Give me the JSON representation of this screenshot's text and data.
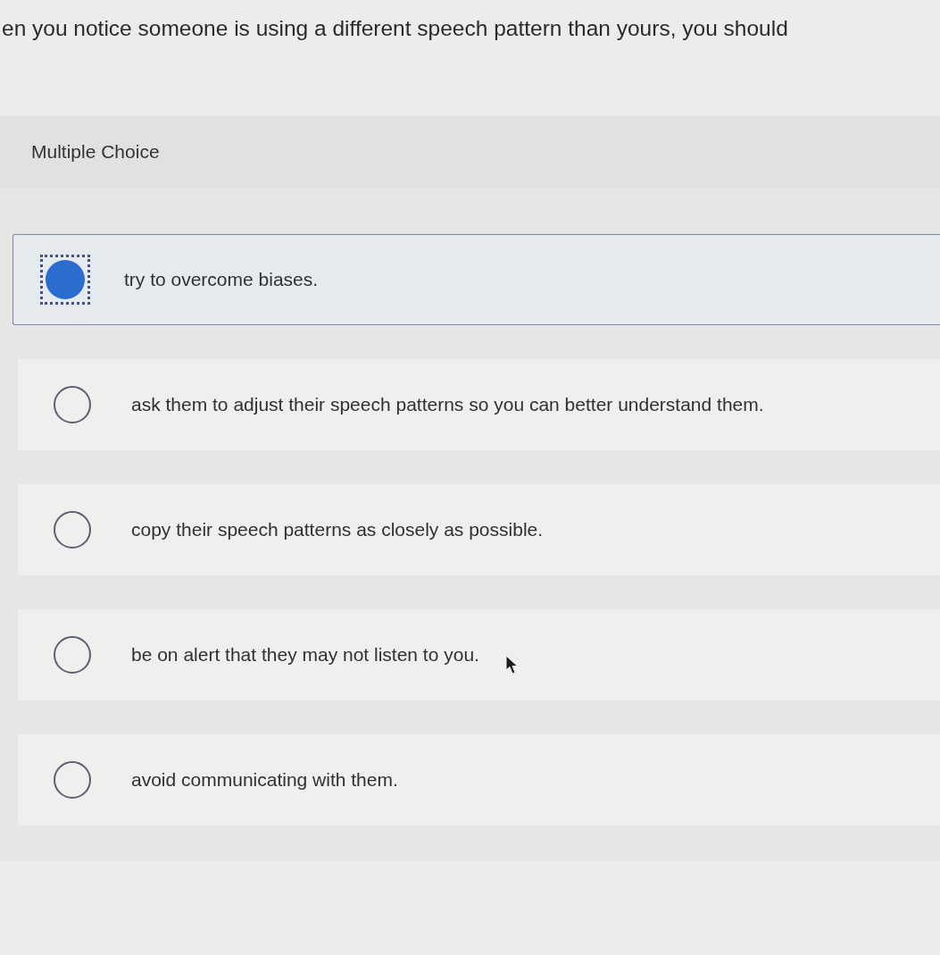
{
  "question": {
    "text": "en you notice someone is using a different speech pattern than yours, you should"
  },
  "question_type": "Multiple Choice",
  "options": [
    {
      "label": "try to overcome biases.",
      "selected": true
    },
    {
      "label": "ask them to adjust their speech patterns so you can better understand them.",
      "selected": false
    },
    {
      "label": "copy their speech patterns as closely as possible.",
      "selected": false
    },
    {
      "label": "be on alert that they may not listen to you.",
      "selected": false
    },
    {
      "label": "avoid communicating with them.",
      "selected": false
    }
  ]
}
